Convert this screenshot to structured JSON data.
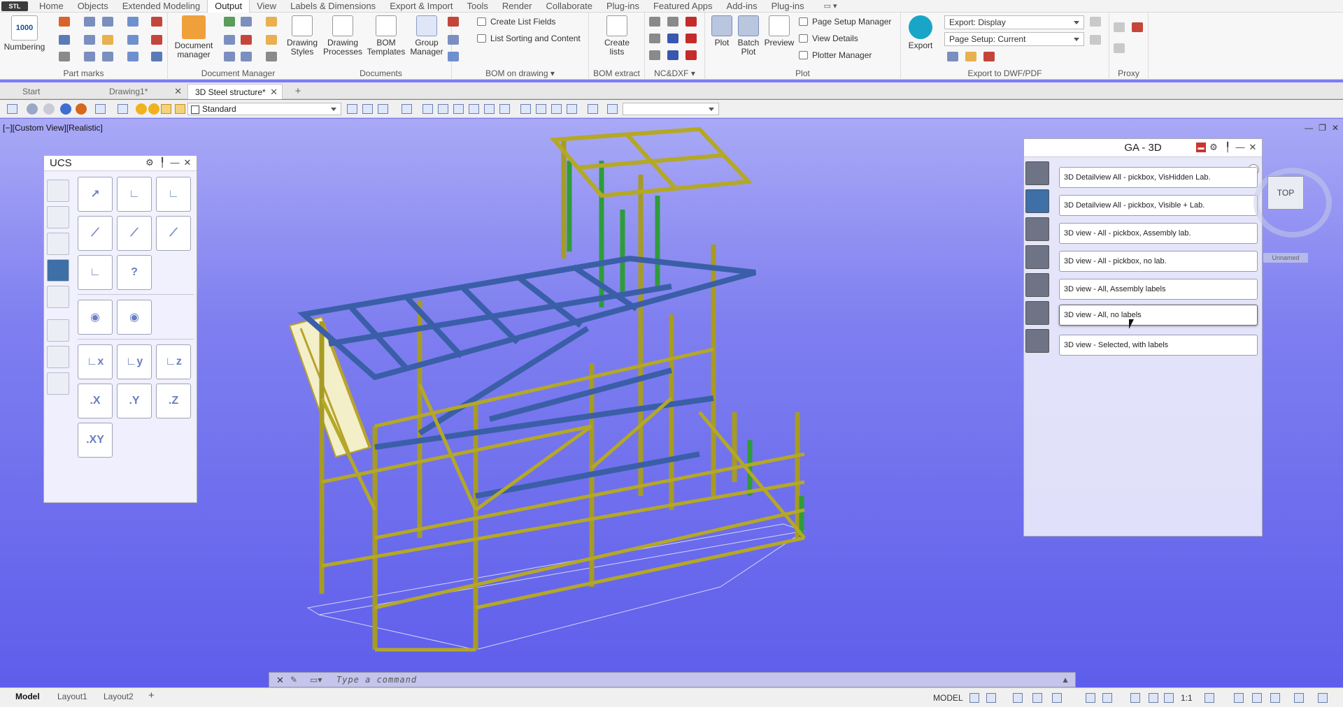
{
  "menubar": {
    "logo": "STL",
    "items": [
      "Home",
      "Objects",
      "Extended Modeling",
      "Output",
      "View",
      "Labels & Dimensions",
      "Export & Import",
      "Tools",
      "Render",
      "Collaborate",
      "Plug-ins",
      "Featured Apps",
      "Add-ins",
      "Plug-ins"
    ],
    "active": "Output"
  },
  "ribbon": {
    "part_marks": {
      "title": "Part marks",
      "numbering_label": "Numbering",
      "numbering_icon_text": "1000"
    },
    "document_manager": {
      "title": "Document Manager",
      "doc_manager_label": "Document manager"
    },
    "documents": {
      "title": "Documents",
      "drawing_styles": "Drawing Styles",
      "drawing_processes": "Drawing Processes",
      "bom_templates": "BOM Templates"
    },
    "bom_on_drawing": {
      "title": "BOM on drawing",
      "group_manager": "Group Manager",
      "create_list_fields": "Create List Fields",
      "list_sorting": "List Sorting and Content"
    },
    "bom_extract": {
      "title": "BOM extract",
      "create_lists": "Create lists"
    },
    "nc_dxf": {
      "title": "NC&DXF"
    },
    "plot": {
      "title": "Plot",
      "plot": "Plot",
      "batch_plot": "Batch Plot",
      "preview": "Preview",
      "page_setup_manager": "Page Setup Manager",
      "view_details": "View Details",
      "plotter_manager": "Plotter Manager"
    },
    "export_dwf": {
      "title": "Export to DWF/PDF",
      "export": "Export",
      "export_display": "Export: Display",
      "page_setup_current": "Page Setup: Current"
    },
    "proxy": {
      "title": "Proxy"
    }
  },
  "doc_tabs": {
    "start": "Start",
    "drawing1": "Drawing1*",
    "steel": "3D Steel structure*"
  },
  "toolbar2": {
    "visual_style": "Standard"
  },
  "viewport": {
    "label": "[−][Custom View][Realistic]",
    "ctrl_min": "—",
    "ctrl_restore": "❐",
    "ctrl_close": "✕"
  },
  "ucs_panel": {
    "title": "UCS",
    "axis_x": ".X",
    "axis_y": ".Y",
    "axis_z": ".Z",
    "axis_xy": ".XY"
  },
  "ga_panel": {
    "title": "GA - 3D",
    "items": [
      "3D Detailview All - pickbox, VisHidden Lab.",
      "3D Detailview All - pickbox, Visible + Lab.",
      "3D view - All - pickbox, Assembly lab.",
      "3D view - All - pickbox, no lab.",
      "3D view - All, Assembly labels",
      "3D view - All, no labels",
      "3D view - Selected, with labels"
    ]
  },
  "viewcube": {
    "face": "TOP",
    "named": "Unnamed"
  },
  "command_line": {
    "placeholder": "Type a command"
  },
  "status_bar": {
    "layout_tabs": [
      "Model",
      "Layout1",
      "Layout2"
    ],
    "model_label": "MODEL",
    "scale": "1:1"
  },
  "colors": {
    "viewport_top": "#a9a9f6",
    "viewport_bottom": "#5d5deb",
    "steel_yellow": "#b4a826",
    "steel_blue": "#3a5fa8",
    "steel_green": "#2e9c3a"
  }
}
